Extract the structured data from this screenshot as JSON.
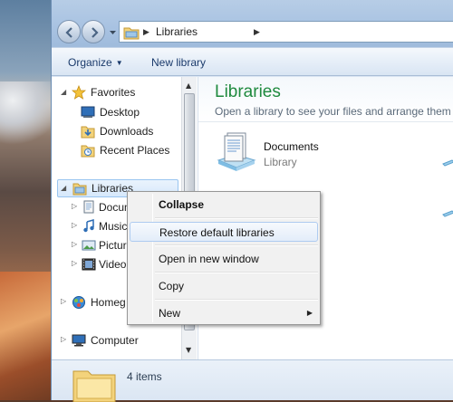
{
  "address_bar": {
    "crumbs": [
      "Libraries"
    ]
  },
  "toolbar": {
    "organize_label": "Organize",
    "new_library_label": "New library"
  },
  "nav_pane": {
    "items": [
      {
        "label": "Favorites",
        "icon": "star-icon"
      },
      {
        "label": "Desktop",
        "icon": "desktop-icon"
      },
      {
        "label": "Downloads",
        "icon": "downloads-folder-icon"
      },
      {
        "label": "Recent Places",
        "icon": "recent-places-icon"
      },
      {
        "label": "Libraries",
        "icon": "libraries-icon"
      },
      {
        "label": "Docum",
        "icon": "documents-icon"
      },
      {
        "label": "Music",
        "icon": "music-icon"
      },
      {
        "label": "Pictur",
        "icon": "pictures-icon"
      },
      {
        "label": "Video",
        "icon": "videos-icon"
      },
      {
        "label": "Homeg",
        "icon": "homegroup-icon"
      },
      {
        "label": "Computer",
        "icon": "computer-icon"
      }
    ]
  },
  "content": {
    "title": "Libraries",
    "subtitle": "Open a library to see your files and arrange them b",
    "libraries": [
      {
        "name": "Documents",
        "type": "Library"
      }
    ]
  },
  "details": {
    "count_text": "4 items"
  },
  "context_menu": {
    "items": [
      {
        "label": "Collapse",
        "bold": true
      },
      {
        "label": "Restore default libraries",
        "highlighted": true
      },
      {
        "label": "Open in new window"
      },
      {
        "label": "Copy"
      },
      {
        "label": "New",
        "submenu": true
      }
    ]
  },
  "colors": {
    "title_green": "#1f8a3e",
    "command_text": "#1a3a6b",
    "menu_highlight_border": "#aecbf0"
  }
}
